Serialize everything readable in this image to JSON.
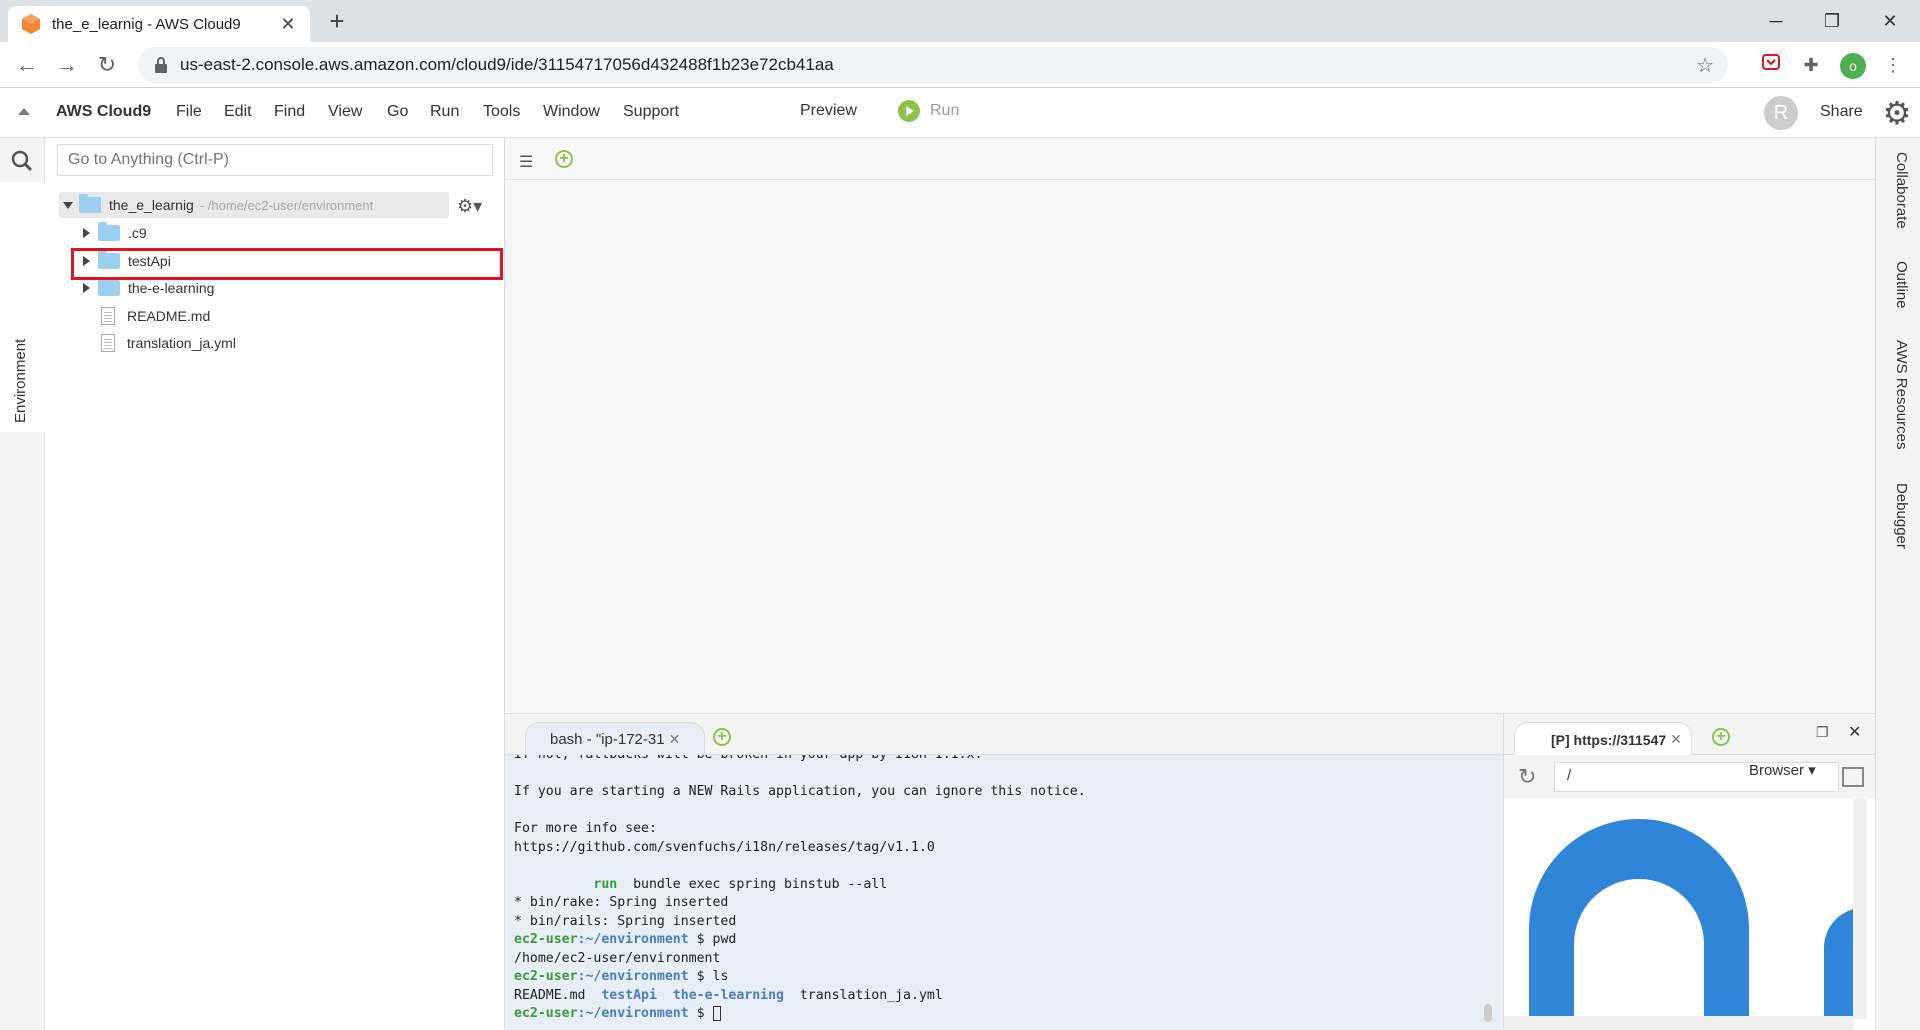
{
  "browser": {
    "tab_title": "the_e_learnig - AWS Cloud9",
    "url": "us-east-2.console.aws.amazon.com/cloud9/ide/31154717056d432488f1b23e72cb41aa",
    "profile_initial": "o"
  },
  "menubar": {
    "brand": "AWS Cloud9",
    "items": [
      "File",
      "Edit",
      "Find",
      "View",
      "Go",
      "Run",
      "Tools",
      "Window",
      "Support"
    ],
    "preview": "Preview",
    "run": "Run",
    "avatar": "R",
    "share": "Share"
  },
  "sidebar": {
    "search_placeholder": "Go to Anything (Ctrl-P)",
    "vertical_tab": "Environment"
  },
  "tree": {
    "root_name": "the_e_learnig",
    "root_path": "- /home/ec2-user/environment",
    "items": [
      {
        "label": ".c9",
        "type": "folder"
      },
      {
        "label": "testApi",
        "type": "folder"
      },
      {
        "label": "the-e-learning",
        "type": "folder"
      },
      {
        "label": "README.md",
        "type": "file"
      },
      {
        "label": "translation_ja.yml",
        "type": "file"
      }
    ]
  },
  "right_tabs": [
    "Collaborate",
    "Outline",
    "AWS Resources",
    "Debugger"
  ],
  "terminal": {
    "tab_label": "bash - \"ip-172-31",
    "lines": {
      "l0": "If not, fallbacks will be broken in your app by I18n 1.1.x.",
      "l1": "",
      "l2": "If you are starting a NEW Rails application, you can ignore this notice.",
      "l3": "",
      "l4": "For more info see:",
      "l5": "https://github.com/svenfuchs/i18n/releases/tag/v1.1.0",
      "l6": "",
      "run_kw": "run",
      "run_cmd": "  bundle exec spring binstub --all",
      "l8": "* bin/rake: Spring inserted",
      "l9": "* bin/rails: Spring inserted",
      "prompt_user": "ec2-user",
      "prompt_path": ":~/environment",
      "prompt_sign": " $ ",
      "cmd_pwd": "pwd",
      "out_pwd": "/home/ec2-user/environment",
      "cmd_ls": "ls",
      "ls_readme": "README.md  ",
      "ls_testapi": "testApi",
      "ls_sep1": "  ",
      "ls_elearning": "the-e-learning",
      "ls_translation": "  translation_ja.yml"
    }
  },
  "preview": {
    "tab_label": "[P] https://311547",
    "url_value": "/",
    "browser_select": "Browser ▾"
  },
  "colors": {
    "accent_green": "#8bc34a",
    "highlight_red": "#e0141d",
    "folder_blue": "#9cd0f0",
    "preview_logo_blue": "#2f86d8"
  }
}
